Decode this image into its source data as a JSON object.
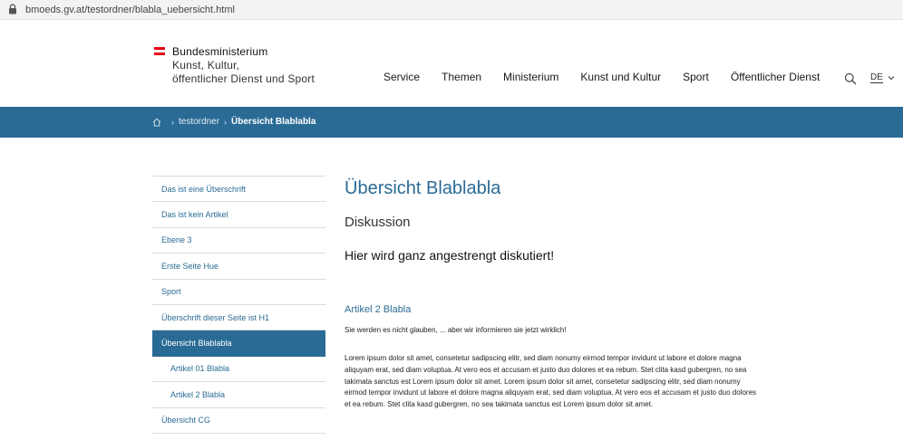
{
  "browser": {
    "url": "bmoeds.gv.at/testordner/blabla_uebersicht.html"
  },
  "logo": {
    "line1": "Bundesministerium",
    "line2": "Kunst, Kultur,",
    "line3": "öffentlicher Dienst und Sport",
    "flag_colors": [
      "#e30613",
      "#ffffff",
      "#e30613"
    ]
  },
  "nav": {
    "items": [
      "Service",
      "Themen",
      "Ministerium",
      "Kunst und Kultur",
      "Sport",
      "Öffentlicher Dienst"
    ],
    "search_icon": "search-icon",
    "language": "DE"
  },
  "breadcrumb": {
    "home_icon": "home-icon",
    "items": [
      "testordner",
      "Übersicht Blablabla"
    ]
  },
  "sidebar": {
    "items": [
      {
        "label": "Das ist eine Überschrift",
        "level": 1,
        "active": false
      },
      {
        "label": "Das ist kein Artikel",
        "level": 1,
        "active": false
      },
      {
        "label": "Ebene 3",
        "level": 1,
        "active": false
      },
      {
        "label": "Erste Seite Hue",
        "level": 1,
        "active": false
      },
      {
        "label": "Sport",
        "level": 1,
        "active": false
      },
      {
        "label": "Überschrift dieser Seite ist H1",
        "level": 1,
        "active": false
      },
      {
        "label": "Übersicht Blablabla",
        "level": 1,
        "active": true
      },
      {
        "label": "Artikel 01 Blabla",
        "level": 2,
        "active": false
      },
      {
        "label": "Artikel 2 Blabla",
        "level": 2,
        "active": false
      },
      {
        "label": "Übersicht CG",
        "level": 1,
        "active": false
      }
    ]
  },
  "main": {
    "title": "Übersicht Blablabla",
    "subheading": "Diskussion",
    "lead": "Hier wird ganz angestrengt diskutiert!",
    "article": {
      "title": "Artikel 2 Blabla",
      "intro": "Sie werden es nicht glauben, ... aber wir informieren sie jetzt wirklich!",
      "body": "Lorem ipsum dolor sit amet, consetetur sadipscing elitr, sed diam nonumy eirmod tempor invidunt ut labore et dolore magna aliquyam erat, sed diam voluptua. At vero eos et accusam et justo duo dolores et ea rebum. Stet clita kasd gubergren, no sea takimata sanctus est Lorem ipsum dolor sit amet. Lorem ipsum dolor sit amet, consetetur sadipscing elitr, sed diam nonumy eirmod tempor invidunt ut labore et dolore magna aliquyam erat, sed diam voluptua. At vero eos et accusam et justo duo dolores et ea rebum. Stet clita kasd gubergren, no sea takimata sanctus est Lorem ipsum dolor sit amet."
    }
  },
  "colors": {
    "brand_blue": "#2a6b95",
    "band_text": "#ffffff"
  }
}
